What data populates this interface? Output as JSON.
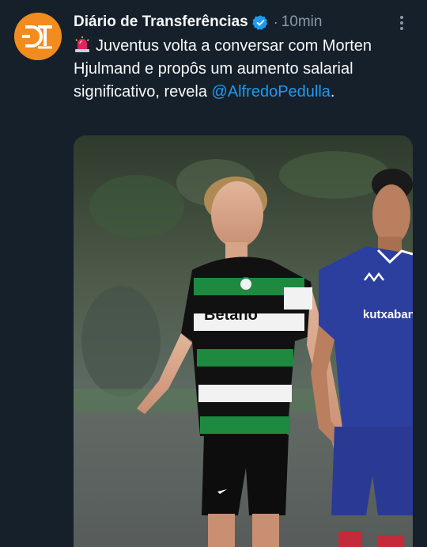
{
  "tweet": {
    "author": {
      "display_name": "Diário de Transferências",
      "verified": true
    },
    "separator": "·",
    "timestamp": "10min",
    "text_before": "Juventus volta a conversar com Morten Hjulmand e propôs um aumento salarial significativo, revela ",
    "mention": "@AlfredoPedulla",
    "text_after": ".",
    "media": {
      "description": "Photo of a football player in a green-and-white striped kit next to a player in a blue kit",
      "shirt_sponsor_left": "Betano",
      "shirt_sponsor_right": "kutxabank"
    }
  },
  "colors": {
    "background": "#15202b",
    "text": "#f7f9f9",
    "secondary": "#8b98a5",
    "link": "#1d9bf0",
    "avatar": "#f28c1f",
    "verified": "#1d9bf0"
  },
  "icons": {
    "avatar_logo": "dt-logo",
    "badge": "verified-badge-icon",
    "siren": "police-siren-icon",
    "menu": "more-options-icon"
  }
}
